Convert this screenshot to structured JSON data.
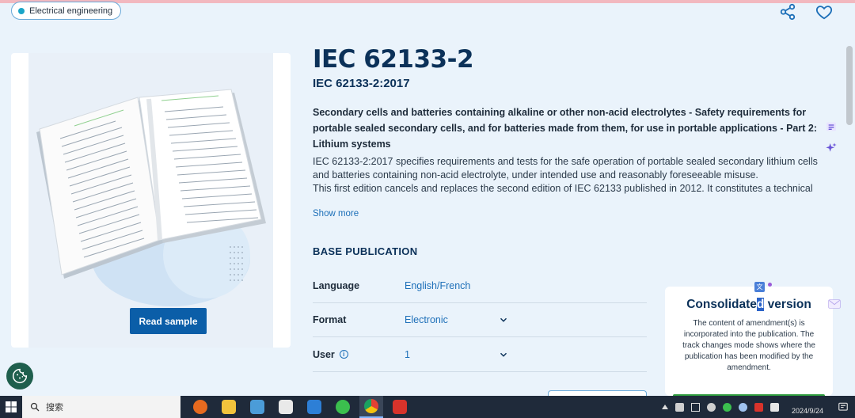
{
  "header": {
    "category": "Electrical engineering",
    "icons": [
      "share-icon",
      "heart-icon"
    ]
  },
  "product": {
    "title": "IEC 62133-2",
    "reference": "IEC 62133-2:2017",
    "headline": "Secondary cells and batteries containing alkaline or other non-acid electrolytes - Safety requirements for portable sealed secondary cells, and for batteries made from them, for use in portable applications - Part 2: Lithium systems",
    "description": "IEC 62133-2:2017 specifies requirements and tests for the safe operation of portable sealed secondary lithium cells and batteries containing non-acid electrolyte, under intended use and reasonably foreseeable misuse.\nThis first edition cancels and replaces the second edition of IEC 62133 published in 2012. It constitutes a technical",
    "show_more": "Show more",
    "read_sample": "Read sample"
  },
  "base_publication": {
    "title": "BASE PUBLICATION",
    "rows": [
      {
        "label": "Language",
        "value": "English/French"
      },
      {
        "label": "Format",
        "value": "Electronic"
      },
      {
        "label": "User",
        "value": "1"
      }
    ]
  },
  "consolidated": {
    "title_part1": "Consolidate",
    "title_highlight": "d",
    "title_part2": " version",
    "text": "The content of amendment(s) is incorporated into the publication. The track changes mode shows where the publication has been modified by the amendment."
  },
  "taskbar": {
    "search_label": "搜索",
    "date": "2024/9/24"
  },
  "colors": {
    "brand_dark": "#0b3159",
    "link": "#1d6fb8",
    "button": "#0b5ea8",
    "background": "#eaf3fb"
  }
}
